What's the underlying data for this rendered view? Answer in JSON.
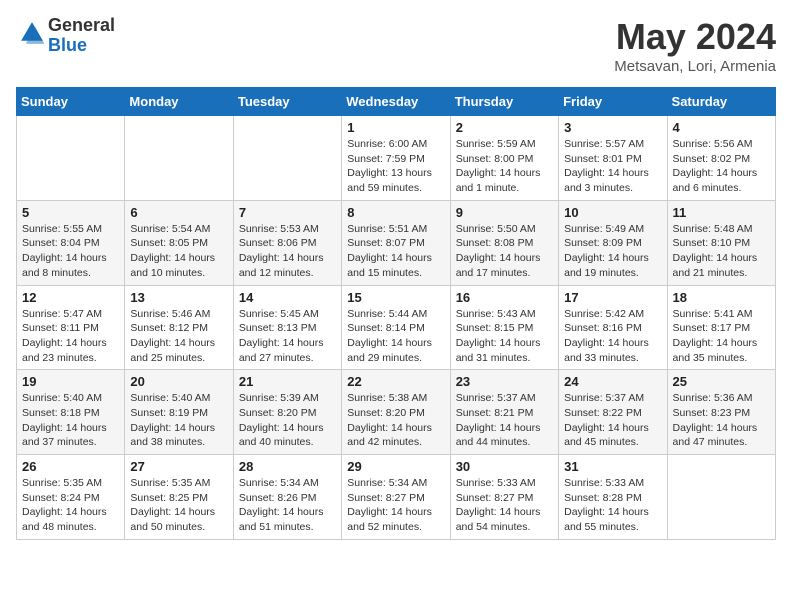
{
  "header": {
    "logo_general": "General",
    "logo_blue": "Blue",
    "month_title": "May 2024",
    "location": "Metsavan, Lori, Armenia"
  },
  "days_of_week": [
    "Sunday",
    "Monday",
    "Tuesday",
    "Wednesday",
    "Thursday",
    "Friday",
    "Saturday"
  ],
  "weeks": [
    [
      {
        "day": "",
        "info": ""
      },
      {
        "day": "",
        "info": ""
      },
      {
        "day": "",
        "info": ""
      },
      {
        "day": "1",
        "info": "Sunrise: 6:00 AM\nSunset: 7:59 PM\nDaylight: 13 hours\nand 59 minutes."
      },
      {
        "day": "2",
        "info": "Sunrise: 5:59 AM\nSunset: 8:00 PM\nDaylight: 14 hours\nand 1 minute."
      },
      {
        "day": "3",
        "info": "Sunrise: 5:57 AM\nSunset: 8:01 PM\nDaylight: 14 hours\nand 3 minutes."
      },
      {
        "day": "4",
        "info": "Sunrise: 5:56 AM\nSunset: 8:02 PM\nDaylight: 14 hours\nand 6 minutes."
      }
    ],
    [
      {
        "day": "5",
        "info": "Sunrise: 5:55 AM\nSunset: 8:04 PM\nDaylight: 14 hours\nand 8 minutes."
      },
      {
        "day": "6",
        "info": "Sunrise: 5:54 AM\nSunset: 8:05 PM\nDaylight: 14 hours\nand 10 minutes."
      },
      {
        "day": "7",
        "info": "Sunrise: 5:53 AM\nSunset: 8:06 PM\nDaylight: 14 hours\nand 12 minutes."
      },
      {
        "day": "8",
        "info": "Sunrise: 5:51 AM\nSunset: 8:07 PM\nDaylight: 14 hours\nand 15 minutes."
      },
      {
        "day": "9",
        "info": "Sunrise: 5:50 AM\nSunset: 8:08 PM\nDaylight: 14 hours\nand 17 minutes."
      },
      {
        "day": "10",
        "info": "Sunrise: 5:49 AM\nSunset: 8:09 PM\nDaylight: 14 hours\nand 19 minutes."
      },
      {
        "day": "11",
        "info": "Sunrise: 5:48 AM\nSunset: 8:10 PM\nDaylight: 14 hours\nand 21 minutes."
      }
    ],
    [
      {
        "day": "12",
        "info": "Sunrise: 5:47 AM\nSunset: 8:11 PM\nDaylight: 14 hours\nand 23 minutes."
      },
      {
        "day": "13",
        "info": "Sunrise: 5:46 AM\nSunset: 8:12 PM\nDaylight: 14 hours\nand 25 minutes."
      },
      {
        "day": "14",
        "info": "Sunrise: 5:45 AM\nSunset: 8:13 PM\nDaylight: 14 hours\nand 27 minutes."
      },
      {
        "day": "15",
        "info": "Sunrise: 5:44 AM\nSunset: 8:14 PM\nDaylight: 14 hours\nand 29 minutes."
      },
      {
        "day": "16",
        "info": "Sunrise: 5:43 AM\nSunset: 8:15 PM\nDaylight: 14 hours\nand 31 minutes."
      },
      {
        "day": "17",
        "info": "Sunrise: 5:42 AM\nSunset: 8:16 PM\nDaylight: 14 hours\nand 33 minutes."
      },
      {
        "day": "18",
        "info": "Sunrise: 5:41 AM\nSunset: 8:17 PM\nDaylight: 14 hours\nand 35 minutes."
      }
    ],
    [
      {
        "day": "19",
        "info": "Sunrise: 5:40 AM\nSunset: 8:18 PM\nDaylight: 14 hours\nand 37 minutes."
      },
      {
        "day": "20",
        "info": "Sunrise: 5:40 AM\nSunset: 8:19 PM\nDaylight: 14 hours\nand 38 minutes."
      },
      {
        "day": "21",
        "info": "Sunrise: 5:39 AM\nSunset: 8:20 PM\nDaylight: 14 hours\nand 40 minutes."
      },
      {
        "day": "22",
        "info": "Sunrise: 5:38 AM\nSunset: 8:20 PM\nDaylight: 14 hours\nand 42 minutes."
      },
      {
        "day": "23",
        "info": "Sunrise: 5:37 AM\nSunset: 8:21 PM\nDaylight: 14 hours\nand 44 minutes."
      },
      {
        "day": "24",
        "info": "Sunrise: 5:37 AM\nSunset: 8:22 PM\nDaylight: 14 hours\nand 45 minutes."
      },
      {
        "day": "25",
        "info": "Sunrise: 5:36 AM\nSunset: 8:23 PM\nDaylight: 14 hours\nand 47 minutes."
      }
    ],
    [
      {
        "day": "26",
        "info": "Sunrise: 5:35 AM\nSunset: 8:24 PM\nDaylight: 14 hours\nand 48 minutes."
      },
      {
        "day": "27",
        "info": "Sunrise: 5:35 AM\nSunset: 8:25 PM\nDaylight: 14 hours\nand 50 minutes."
      },
      {
        "day": "28",
        "info": "Sunrise: 5:34 AM\nSunset: 8:26 PM\nDaylight: 14 hours\nand 51 minutes."
      },
      {
        "day": "29",
        "info": "Sunrise: 5:34 AM\nSunset: 8:27 PM\nDaylight: 14 hours\nand 52 minutes."
      },
      {
        "day": "30",
        "info": "Sunrise: 5:33 AM\nSunset: 8:27 PM\nDaylight: 14 hours\nand 54 minutes."
      },
      {
        "day": "31",
        "info": "Sunrise: 5:33 AM\nSunset: 8:28 PM\nDaylight: 14 hours\nand 55 minutes."
      },
      {
        "day": "",
        "info": ""
      }
    ]
  ]
}
